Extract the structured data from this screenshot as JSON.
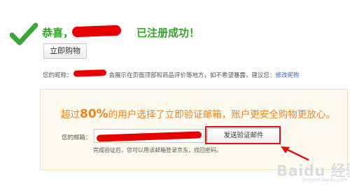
{
  "success": {
    "prefix": "恭喜，",
    "suffix": "已注册成功！"
  },
  "actions": {
    "buy_label": "立即购物"
  },
  "nickname": {
    "label": "您的昵称：",
    "notice": "会展示在页面顶部和商品评价等地方，如不希望暴露，建议您：",
    "link": "修改昵称"
  },
  "verify": {
    "promo_prefix": "超过",
    "promo_percent": "80%",
    "promo_suffix": "的用户选择了立即验证邮箱，账户更安全购物更放心。",
    "email_label": "您的邮箱：",
    "send_label": "发送验证邮件",
    "hint": "完成验证后，您可以用该邮箱登录京东，找回密码。"
  },
  "watermark": {
    "text": "Baidu 经验",
    "sub": "jingyan.baidu.com"
  },
  "colors": {
    "success_green": "#37a12b",
    "promo_orange": "#ec8420",
    "annotation_red": "#e01010",
    "link_blue": "#3366cc"
  },
  "icons": [
    "check-icon",
    "arrow-icon"
  ]
}
